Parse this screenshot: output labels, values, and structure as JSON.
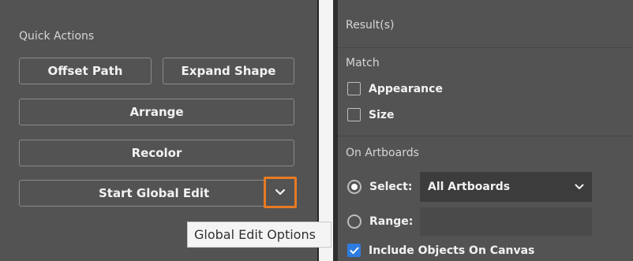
{
  "quick_actions": {
    "title": "Quick Actions",
    "offset_path": "Offset Path",
    "expand_shape": "Expand Shape",
    "arrange": "Arrange",
    "recolor": "Recolor",
    "start_global_edit": "Start Global Edit",
    "options_icon": "chevron-down-icon"
  },
  "tooltip": {
    "text": "Global Edit Options"
  },
  "result_panel": {
    "title": "Result(s)",
    "match": {
      "title": "Match",
      "options": [
        {
          "label": "Appearance",
          "checked": false
        },
        {
          "label": "Size",
          "checked": false
        }
      ]
    },
    "on_artboards": {
      "title": "On Artboards",
      "select_label": "Select:",
      "select_value": "All Artboards",
      "range_label": "Range:",
      "include_label": "Include Objects On Canvas",
      "include_checked": true
    }
  },
  "colors": {
    "panel_bg": "#535353",
    "accent_orange": "#e77b25",
    "checkbox_blue": "#2f7ce0"
  }
}
